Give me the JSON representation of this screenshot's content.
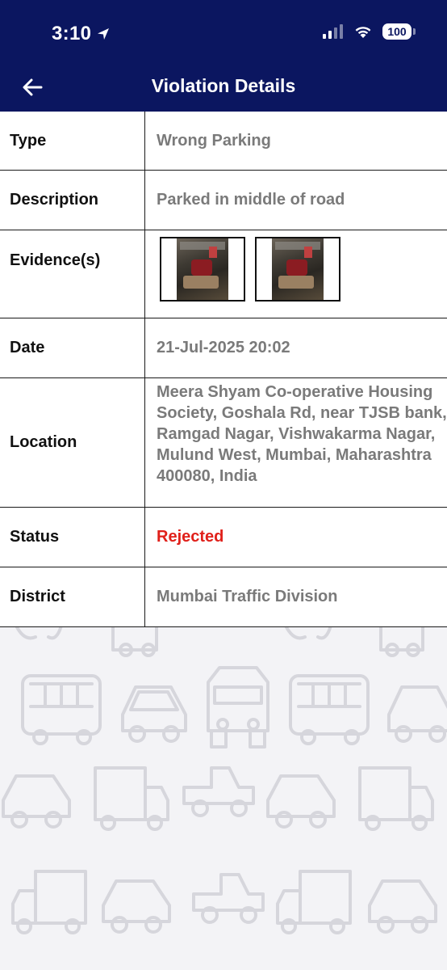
{
  "status_bar": {
    "time": "3:10",
    "battery": "100"
  },
  "nav": {
    "title": "Violation Details"
  },
  "details": {
    "type_label": "Type",
    "type_value": "Wrong Parking",
    "description_label": "Description",
    "description_value": "Parked in middle of road",
    "evidence_label": "Evidence(s)",
    "date_label": "Date",
    "date_value": "21-Jul-2025 20:02",
    "location_label": "Location",
    "location_value": "Meera Shyam Co-operative Housing Society, Goshala Rd, near TJSB bank, Ramgad Nagar, Vishwakarma Nagar, Mulund West, Mumbai, Maharashtra 400080, India",
    "status_label": "Status",
    "status_value": "Rejected",
    "district_label": "District",
    "district_value": "Mumbai Traffic Division"
  },
  "colors": {
    "header_bg": "#0b1660",
    "status_rejected": "#e0201a",
    "value_text": "#7a7a7a"
  },
  "icons": {
    "back": "arrow-left-icon",
    "location": "location-arrow-icon",
    "signal": "cellular-signal-icon",
    "wifi": "wifi-icon",
    "battery": "battery-icon"
  }
}
